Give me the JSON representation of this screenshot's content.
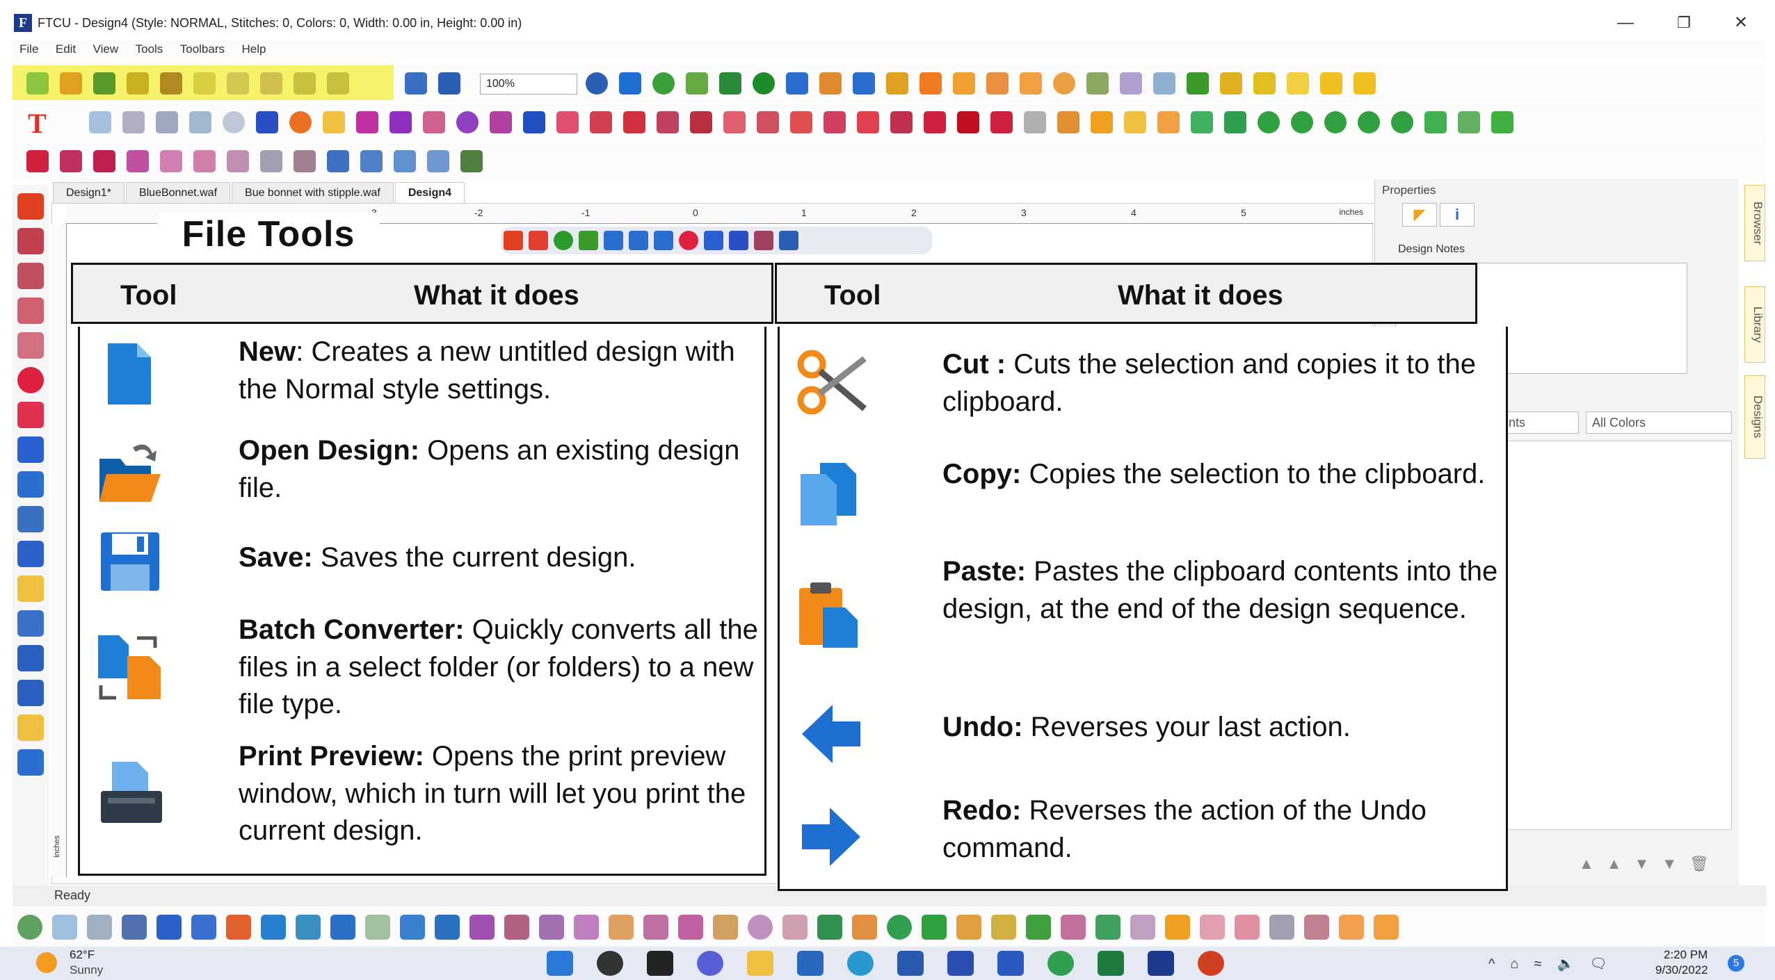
{
  "window": {
    "title": "FTCU - Design4 (Style: NORMAL, Stitches: 0, Colors: 0, Width: 0.00 in, Height: 0.00 in)",
    "minimize": "—",
    "restore": "❐",
    "close": "✕"
  },
  "menu": [
    "File",
    "Edit",
    "View",
    "Tools",
    "Toolbars",
    "Help"
  ],
  "toolbar": {
    "zoom": "100%"
  },
  "tabs": [
    "Design1*",
    "BlueBonnet.waf",
    "Bue bonnet with stipple.waf",
    "Design4"
  ],
  "ruler": {
    "ticks": [
      "3",
      "-2",
      "-1",
      "0",
      "1",
      "2",
      "3",
      "4",
      "5"
    ],
    "unit": "inches",
    "v_unit": "inches"
  },
  "properties": {
    "title": "Properties",
    "tab_info": "i",
    "design_notes": "Design Notes",
    "thread_filter": "nts",
    "color_filter": "All Colors",
    "list_controls": "▲▲▼▼🗑"
  },
  "side_tabs": [
    "Browser",
    "Library",
    "Designs"
  ],
  "status": {
    "text": "Ready"
  },
  "taskbar": {
    "temp": "62°F",
    "weather": "Sunny",
    "time": "2:20 PM",
    "date": "9/30/2022",
    "notifications": "5",
    "tray": "^⌂≈🔈🗨"
  },
  "slide": {
    "title": "File Tools",
    "headers": {
      "tool": "Tool",
      "what": "What it does"
    },
    "left_tools": [
      {
        "name": "New",
        "sep": ":",
        "desc": " Creates a new untitled design with the Normal style settings.",
        "icon": "new-file-icon"
      },
      {
        "name": "Open Design:",
        "sep": "",
        "desc": " Opens an existing design file.",
        "icon": "open-folder-icon"
      },
      {
        "name": "Save:",
        "sep": "",
        "desc": " Saves the current design.",
        "icon": "save-icon"
      },
      {
        "name": "Batch Converter:",
        "sep": "",
        "desc": " Quickly converts all the files in a select folder (or folders) to a new file type.",
        "icon": "batch-convert-icon"
      },
      {
        "name": "Print Preview:",
        "sep": "",
        "desc": " Opens the print preview window, which in turn will let you print the current design.",
        "icon": "printer-icon"
      }
    ],
    "right_tools": [
      {
        "name": "Cut :",
        "sep": "",
        "desc": " Cuts the selection and copies it to the clipboard.",
        "icon": "scissors-icon"
      },
      {
        "name": "Copy:",
        "sep": "",
        "desc": " Copies the selection to the clipboard.",
        "icon": "copy-icon"
      },
      {
        "name": "Paste:",
        "sep": "",
        "desc": " Pastes the clipboard contents into the design, at the end of the design sequence.",
        "icon": "paste-icon"
      },
      {
        "name": "Undo:",
        "sep": "",
        "desc": " Reverses your last action.",
        "icon": "undo-arrow-icon"
      },
      {
        "name": "Redo:",
        "sep": "",
        "desc": " Reverses the action of the Undo command.",
        "icon": "redo-arrow-icon"
      }
    ]
  },
  "colors": {
    "highlight": "#f6f36a",
    "icon_blue": "#1e7fd6",
    "icon_orange": "#f28a1a"
  }
}
